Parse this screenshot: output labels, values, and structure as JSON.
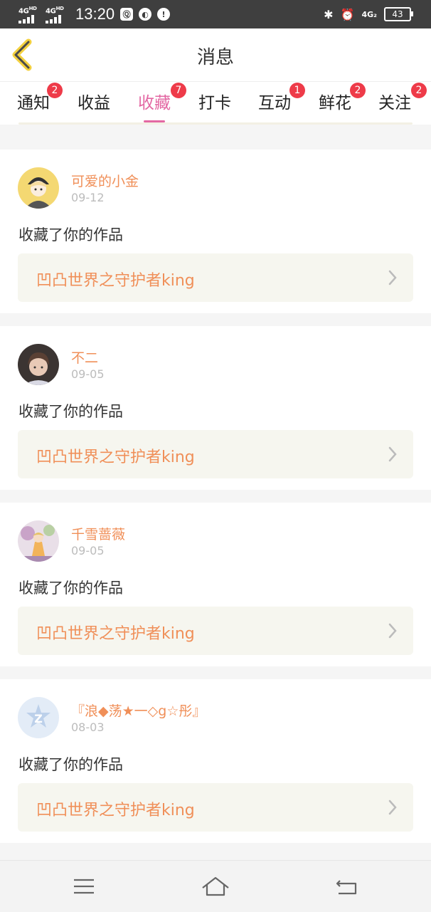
{
  "status_bar": {
    "signal1_label": "4G",
    "signal1_sup": "HD",
    "signal2_label": "4G",
    "signal2_sup": "HD",
    "time": "13:20",
    "icon1": "Ⓠ",
    "icon2": "◐",
    "icon3": "!",
    "bluetooth": "✱",
    "alarm": "⏰",
    "network": "4G₂",
    "battery": "43"
  },
  "header": {
    "title": "消息",
    "back_icon": "chevron-left-icon"
  },
  "tabs": [
    {
      "label": "通知",
      "badge": "2"
    },
    {
      "label": "收益",
      "badge": ""
    },
    {
      "label": "收藏",
      "badge": "7",
      "active": true
    },
    {
      "label": "打卡",
      "badge": ""
    },
    {
      "label": "互动",
      "badge": "1"
    },
    {
      "label": "鲜花",
      "badge": "2"
    },
    {
      "label": "关注",
      "badge": "2"
    }
  ],
  "messages": [
    {
      "name": "可爱的小金",
      "date": "09-12",
      "action": "收藏了你的作品",
      "work": "凹凸世界之守护者king"
    },
    {
      "name": "不二",
      "date": "09-05",
      "action": "收藏了你的作品",
      "work": "凹凸世界之守护者king"
    },
    {
      "name": "千雪蔷薇",
      "date": "09-05",
      "action": "收藏了你的作品",
      "work": "凹凸世界之守护者king"
    },
    {
      "name": "『浪◆荡★一◇g☆彤』",
      "date": "08-03",
      "action": "收藏了你的作品",
      "work": "凹凸世界之守护者king"
    }
  ],
  "colors": {
    "accent": "#e368a3",
    "name_color": "#f08f58",
    "badge": "#ee3b49",
    "status_bar": "#3f3f3f"
  },
  "nav_bar": {
    "menu_icon": "menu-icon",
    "home_icon": "home-icon",
    "back_icon": "back-icon"
  }
}
